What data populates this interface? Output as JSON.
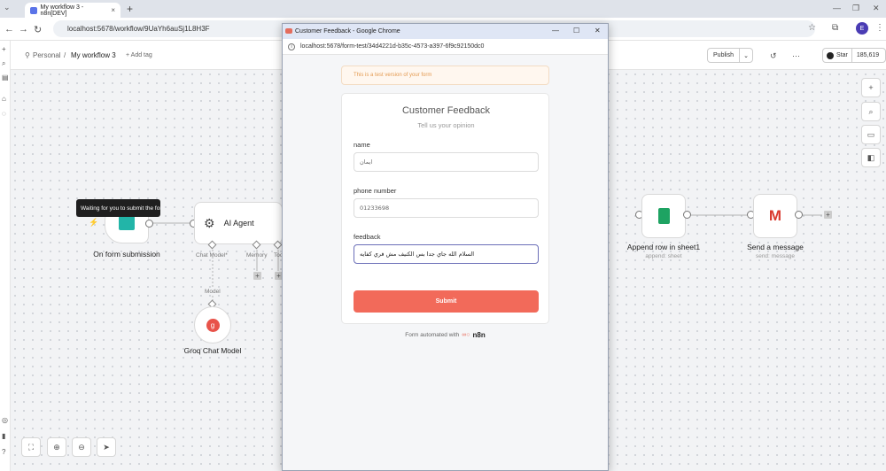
{
  "browser": {
    "tab_title": "My workflow 3 - n8n[DEV]",
    "url": "localhost:5678/workflow/9UaYh6auSj1L8H3F",
    "profile_initial": "E"
  },
  "header": {
    "breadcrumb_project": "Personal",
    "breadcrumb_sep": "/",
    "workflow_name": "My workflow 3",
    "add_tag": "+ Add tag",
    "publish_label": "Publish",
    "github_star_label": "Star",
    "github_star_count": "185,619"
  },
  "canvas": {
    "tooltip": "Waiting for you to submit the form",
    "nodes": {
      "trigger": {
        "label": "On form submission"
      },
      "agent": {
        "label": "AI Agent",
        "port_chat": "Chat Model*",
        "port_memory": "Memory",
        "port_tool": "Tool"
      },
      "groq": {
        "label": "Groq Chat Model",
        "connector_label": "Model"
      },
      "sheets": {
        "label": "Append row in sheet1",
        "sub": "append: sheet"
      },
      "gmail": {
        "label": "Send a message",
        "sub": "send: message"
      }
    }
  },
  "popup": {
    "window_title": "Customer Feedback - Google Chrome",
    "url": "localhost:5678/form-test/34d4221d-b35c-4573-a397-6f9c92150dc0",
    "test_banner": "This is a test version of your form",
    "form": {
      "title": "Customer Feedback",
      "subtitle": "Tell us your opinion",
      "fields": [
        {
          "label": "name",
          "value": "ايمان"
        },
        {
          "label": "phone number",
          "value": "01233698"
        },
        {
          "label": "feedback",
          "value": "السلام الله جاي جدا بس الكنيف مش فري كفايه"
        }
      ],
      "submit_label": "Submit"
    },
    "footer_text": "Form automated with",
    "footer_brand": "n8n"
  },
  "colors": {
    "accent": "#f26a5a",
    "canvas_bg": "#f2f3f5",
    "banner_text": "#e39a51"
  }
}
